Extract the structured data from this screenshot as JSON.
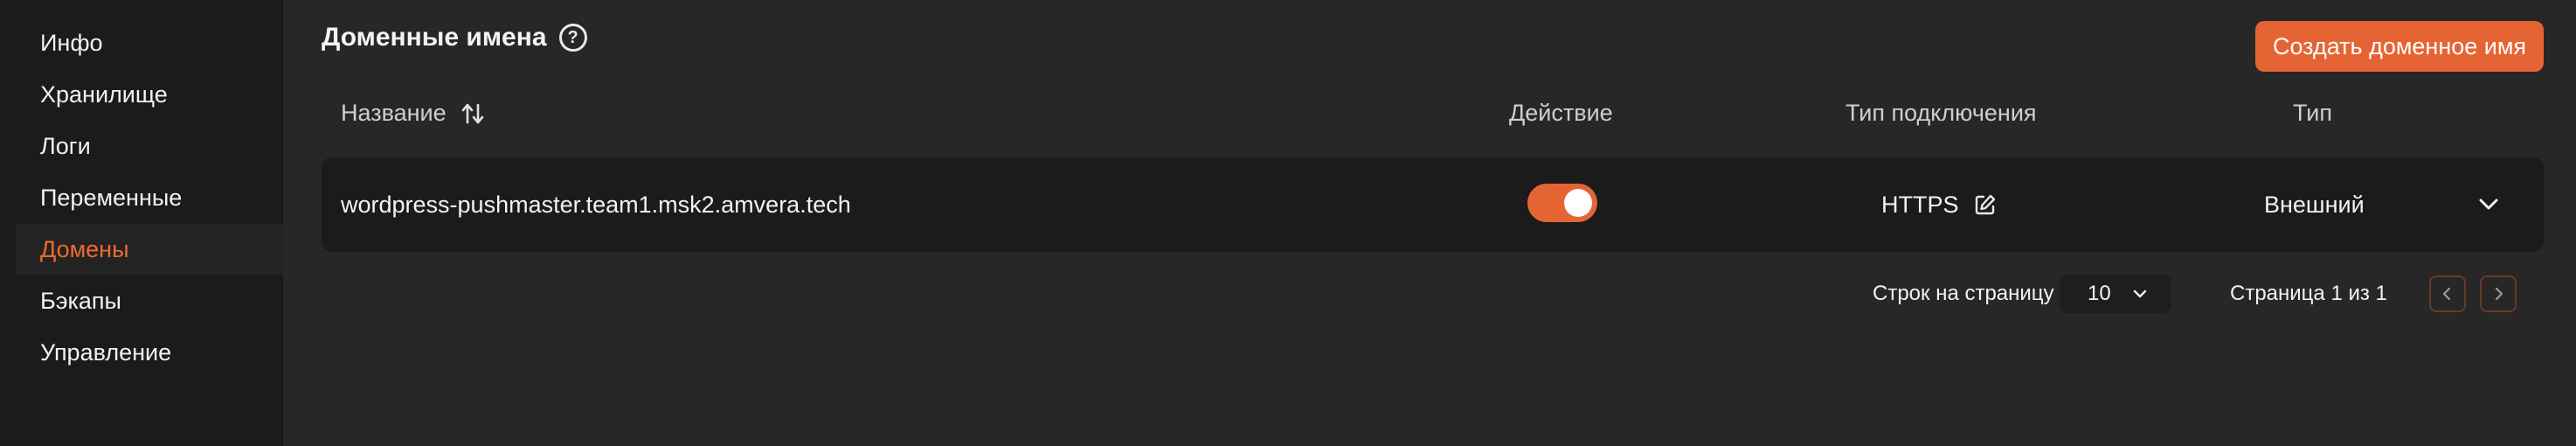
{
  "sidebar": {
    "items": [
      {
        "label": "Инфо"
      },
      {
        "label": "Хранилище"
      },
      {
        "label": "Логи"
      },
      {
        "label": "Переменные"
      },
      {
        "label": "Домены",
        "active": true
      },
      {
        "label": "Бэкапы"
      },
      {
        "label": "Управление"
      }
    ]
  },
  "header": {
    "title": "Доменные имена",
    "help_icon": "?",
    "create_button_label": "Создать доменное имя"
  },
  "table": {
    "columns": {
      "name": "Название",
      "action": "Действие",
      "connection_type": "Тип подключения",
      "type": "Тип"
    },
    "rows": [
      {
        "name": "wordpress-pushmaster.team1.msk2.amvera.tech",
        "action_enabled": true,
        "connection_type": "HTTPS",
        "type": "Внешний"
      }
    ]
  },
  "pagination": {
    "rows_per_page_label": "Строк на страницу",
    "rows_per_page_value": "10",
    "page_label": "Страница 1 из 1"
  },
  "colors": {
    "accent": "#e56434",
    "active_text": "#ed6b2f",
    "background": "#272727",
    "sidebar": "#1b1b1b"
  }
}
